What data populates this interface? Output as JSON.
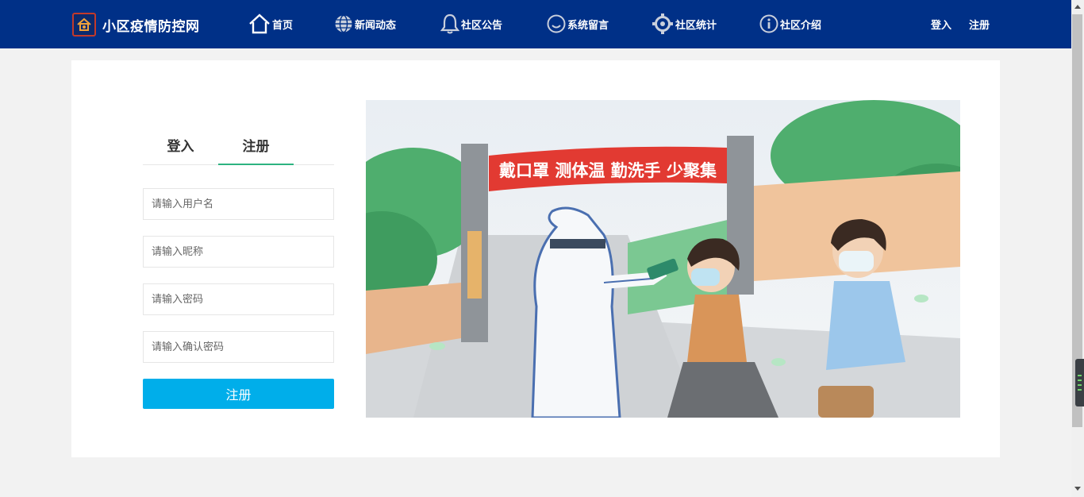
{
  "header": {
    "site_title": "小区疫情防控网",
    "nav": [
      {
        "label": "首页",
        "icon": "home-icon"
      },
      {
        "label": "新闻动态",
        "icon": "globe-icon"
      },
      {
        "label": "社区公告",
        "icon": "bell-icon"
      },
      {
        "label": "系统留言",
        "icon": "smile-icon"
      },
      {
        "label": "社区统计",
        "icon": "gear-icon"
      },
      {
        "label": "社区介绍",
        "icon": "info-icon"
      }
    ],
    "login_label": "登入",
    "register_label": "注册"
  },
  "auth_panel": {
    "tabs": [
      {
        "label": "登入",
        "active": false
      },
      {
        "label": "注册",
        "active": true
      }
    ],
    "fields": {
      "username_placeholder": "请输入用户名",
      "nickname_placeholder": "请输入昵称",
      "password_placeholder": "请输入密码",
      "confirm_password_placeholder": "请输入确认密码"
    },
    "submit_label": "注册"
  },
  "banner": {
    "slogan": "戴口罩 测体温 勤洗手 少聚集"
  },
  "colors": {
    "nav_bg": "#003087",
    "submit_bg": "#00aeea",
    "tab_active_underline": "#2db380",
    "banner_red": "#e23a32"
  }
}
